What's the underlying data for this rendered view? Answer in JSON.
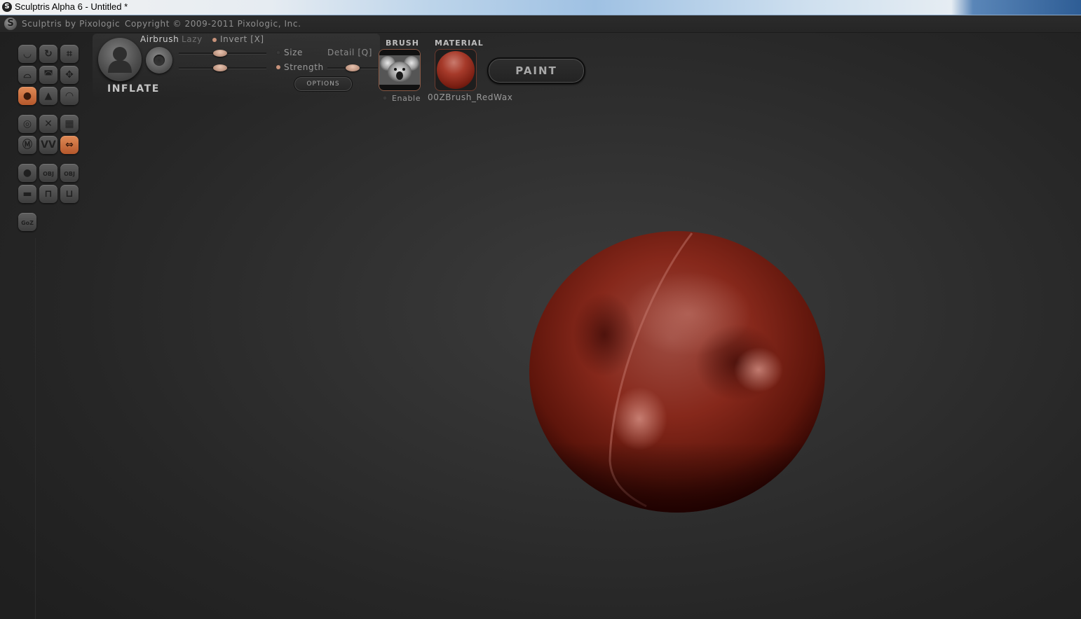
{
  "window": {
    "title": "Sculptris Alpha 6 - Untitled *",
    "logo_icon": "S"
  },
  "header": {
    "app_name": "Sculptris by Pixologic",
    "copyright": "Copyright © 2009-2011 Pixologic, Inc.",
    "logo_icon": "S"
  },
  "toolbar": {
    "tools": [
      {
        "name": "crease-tool",
        "icon": "crease-icon",
        "glyph": "◡",
        "active": false
      },
      {
        "name": "rotate-tool",
        "icon": "rotate-icon",
        "glyph": "↻",
        "active": false
      },
      {
        "name": "scale-tool",
        "icon": "scale-icon",
        "glyph": "⌗",
        "active": false
      },
      {
        "name": "flatten-tool",
        "icon": "flatten-icon",
        "glyph": "⌓",
        "active": false
      },
      {
        "name": "draw-tool",
        "icon": "draw-icon",
        "glyph": "◚",
        "active": false
      },
      {
        "name": "grab-tool",
        "icon": "move-icon",
        "glyph": "✥",
        "active": false
      },
      {
        "name": "inflate-tool",
        "icon": "inflate-icon",
        "glyph": "●",
        "active": true
      },
      {
        "name": "pinch-tool",
        "icon": "pinch-icon",
        "glyph": "▲",
        "active": false
      },
      {
        "name": "smooth-tool",
        "icon": "smooth-icon",
        "glyph": "◠",
        "active": false
      },
      {
        "name": "reduce-brush-tool",
        "icon": "reduce-brush-icon",
        "glyph": "◎",
        "active": false
      },
      {
        "name": "reduce-selection-tool",
        "icon": "reduce-selection-icon",
        "glyph": "✕",
        "active": false
      },
      {
        "name": "wireframe-tool",
        "icon": "wireframe-icon",
        "glyph": "▦",
        "active": false
      },
      {
        "name": "mask-tool",
        "icon": "mask-icon",
        "glyph": "Ⓜ",
        "active": false
      },
      {
        "name": "symmetry-wave-tool",
        "icon": "wave-icon",
        "glyph": "ᐯᐯ",
        "active": false
      },
      {
        "name": "symmetry-tool",
        "icon": "symmetry-icon",
        "glyph": "⇔",
        "active": true
      },
      {
        "name": "new-sphere-button",
        "icon": "sphere-icon",
        "glyph": "●",
        "active": false
      },
      {
        "name": "import-obj-button",
        "icon": "obj-import-icon",
        "glyph": "OBJ",
        "active": false
      },
      {
        "name": "export-obj-button",
        "icon": "obj-export-icon",
        "glyph": "OBJ",
        "active": false
      },
      {
        "name": "new-plane-button",
        "icon": "plane-icon",
        "glyph": "▬",
        "active": false
      },
      {
        "name": "open-button",
        "icon": "open-icon",
        "glyph": "⊓",
        "active": false
      },
      {
        "name": "save-button",
        "icon": "save-icon",
        "glyph": "⊔",
        "active": false
      },
      {
        "name": "goz-button",
        "icon": "goz-icon",
        "glyph": "GoZ",
        "active": false
      }
    ]
  },
  "brush": {
    "name": "INFLATE",
    "airbrush_label": "Airbrush",
    "lazy_label": "Lazy",
    "invert_label": "Invert [X]",
    "size_label": "Size",
    "detail_label": "Detail [Q]",
    "strength_label": "Strength",
    "options_label": "OPTIONS",
    "avatar_icon": "user-silhouette-icon",
    "airbrush_on": true,
    "invert_on": true,
    "size_on": false,
    "strength_on": true,
    "size_value": 0.47,
    "strength_value": 0.47,
    "detail_value": 0.5
  },
  "brush_section": {
    "title": "BRUSH",
    "enable_label": "Enable",
    "texture_icon": "koala-texture-icon",
    "enabled": false
  },
  "material_section": {
    "title": "MATERIAL",
    "material_name": "00ZBrush_RedWax"
  },
  "paint_button": {
    "label": "PAINT"
  },
  "colors": {
    "accent_orange": "#c8693a",
    "material_red": "#8b2a1c",
    "background": "#2b2b2b",
    "title_bar_text": "#000000"
  }
}
